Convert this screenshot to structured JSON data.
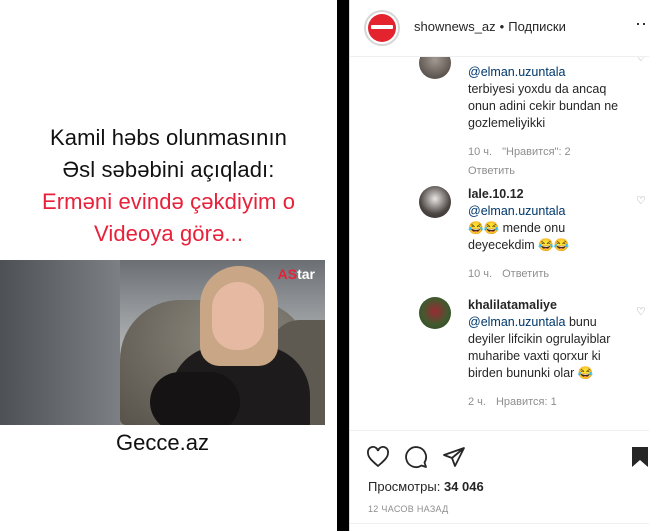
{
  "post_media": {
    "headline_line1": "Kamil həbs olunmasının",
    "headline_line2": "Əsl səbəbini açıqladı:",
    "headline_line3": "Erməni evində çəkdiyim o",
    "headline_line4": "Videoya görə...",
    "video_logo_a": "AS",
    "video_logo_b": "tar",
    "site": "Gecce.az"
  },
  "header": {
    "username": "shownews_az",
    "separator": "•",
    "follow_status": "Подписки",
    "more_icon": "more-icon"
  },
  "comments": [
    {
      "user": "",
      "mention": "@elman.uzuntala",
      "text": "terbiyesi yoxdu da ancaq onun adini cekir bundan ne gozlemeliyikki",
      "time": "10 ч.",
      "likes": "\"Нравится\": 2",
      "reply": "Ответить"
    },
    {
      "user": "lale.10.12",
      "mention": "@elman.uzuntala",
      "text": "😂😂 mende onu deyecekdim 😂😂",
      "time": "10 ч.",
      "likes": "",
      "reply": "Ответить"
    },
    {
      "user": "khalilatamaliye",
      "mention": "@elman.uzuntala",
      "text": "bunu deyiler lifcikin ogrulayiblar muharibe vaxti qorxur ki birden bununki olar 😂",
      "time": "2 ч.",
      "likes": "Нравится: 1",
      "reply": ""
    }
  ],
  "actions": {
    "like_icon": "heart-icon",
    "comment_icon": "comment-icon",
    "share_icon": "share-icon",
    "save_icon": "bookmark-icon",
    "views_label": "Просмотры:",
    "views_count": "34 046",
    "timestamp": "12 ЧАСОВ НАЗАД"
  },
  "colors": {
    "headline_red": "#e8203a",
    "mention_blue": "#00376b",
    "meta_gray": "#8e8e8e"
  }
}
